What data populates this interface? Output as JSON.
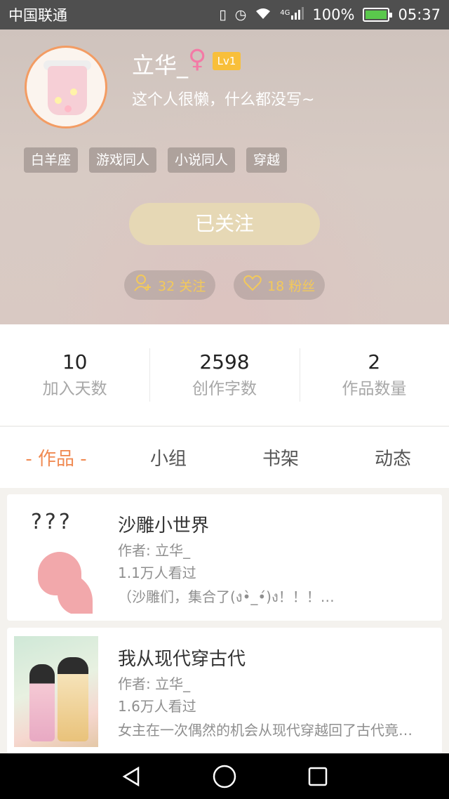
{
  "status_bar": {
    "carrier": "中国联通",
    "network": "4G",
    "battery": "100%",
    "time": "05:37"
  },
  "profile": {
    "name": "立华_",
    "gender_icon": "female-icon",
    "level": "Lv1",
    "bio": "这个人很懒，什么都没写~",
    "tags": [
      "白羊座",
      "游戏同人",
      "小说同人",
      "穿越"
    ],
    "follow_button": "已关注",
    "following": "32 关注",
    "fans": "18 粉丝"
  },
  "counters": [
    {
      "value": "10",
      "label": "加入天数"
    },
    {
      "value": "2598",
      "label": "创作字数"
    },
    {
      "value": "2",
      "label": "作品数量"
    }
  ],
  "tabs": [
    {
      "label": "- 作品 -",
      "active": true
    },
    {
      "label": "小组",
      "active": false
    },
    {
      "label": "书架",
      "active": false
    },
    {
      "label": "动态",
      "active": false
    }
  ],
  "works": [
    {
      "title": "沙雕小世界",
      "author": "作者: 立华_",
      "views": "1.1万人看过",
      "desc": "（沙雕们，集合了(ง•̀_•́)ง！！！…",
      "cover_text": "???"
    },
    {
      "title": "我从现代穿古代",
      "author": "作者: 立华_",
      "views": "1.6万人看过",
      "desc": "女主在一次偶然的机会从现代穿越回了古代竟…"
    }
  ],
  "colors": {
    "accent": "#f08a52",
    "gold": "#f3c95a",
    "follow_button_bg": "#e6d8b5",
    "level_badge": "#f8bf3a"
  }
}
